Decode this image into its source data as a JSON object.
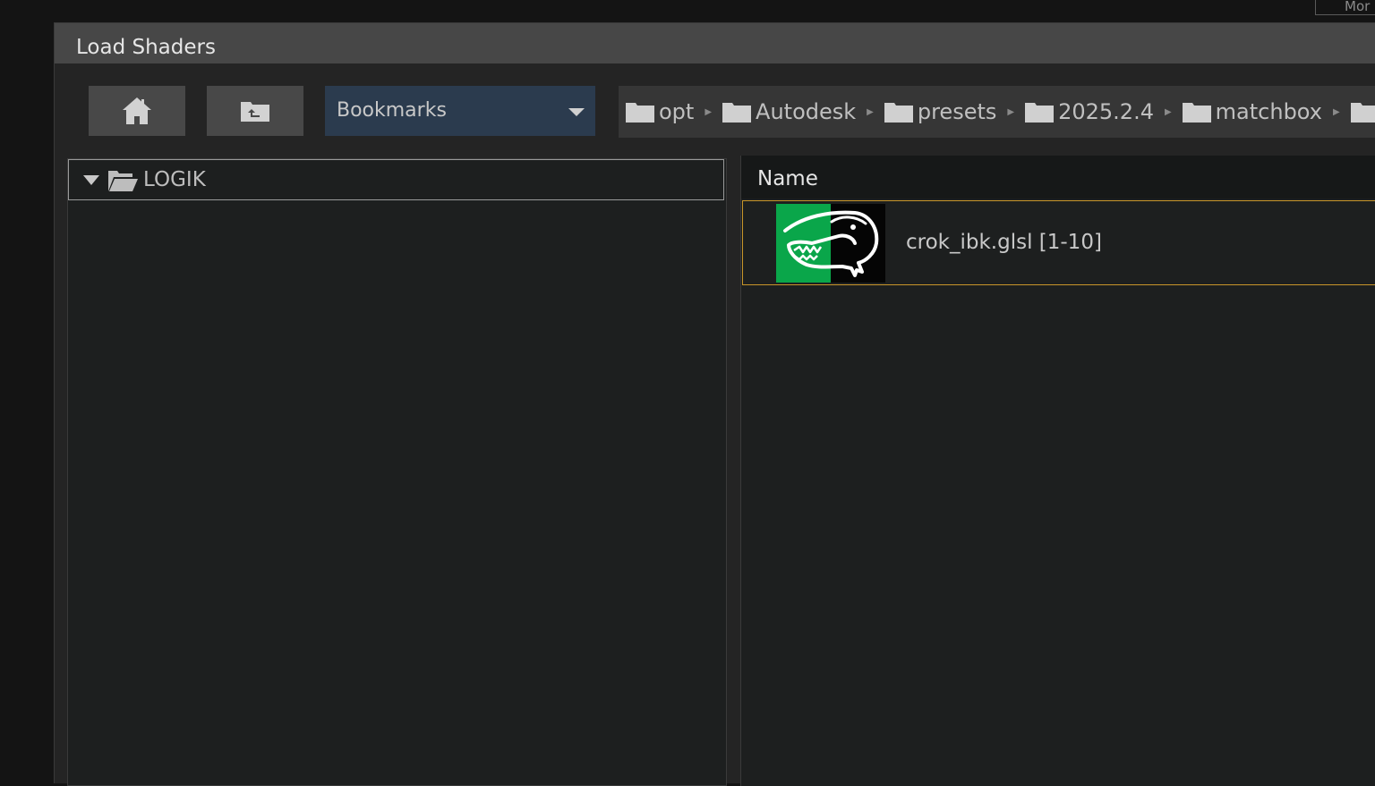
{
  "background": {
    "top_right_label": "Mor"
  },
  "dialog": {
    "title": "Load Shaders"
  },
  "toolbar": {
    "home_icon": "home-icon",
    "parent_folder_icon": "folder-up-icon",
    "bookmarks_label": "Bookmarks"
  },
  "breadcrumb": {
    "items": [
      "opt",
      "Autodesk",
      "presets",
      "2025.2.4",
      "matchbox",
      ""
    ]
  },
  "tree": {
    "root_label": "LOGIK",
    "expanded": true
  },
  "file_list": {
    "column_header": "Name",
    "files": [
      {
        "name": "crok_ibk.glsl [1-10]",
        "selected": true,
        "thumbnail_icon": "crocodile-logo-icon"
      }
    ]
  },
  "colors": {
    "selection_border": "#c9962a",
    "bookmarks_bg": "#2b3b4e",
    "thumbnail_green": "#0aa64a"
  }
}
